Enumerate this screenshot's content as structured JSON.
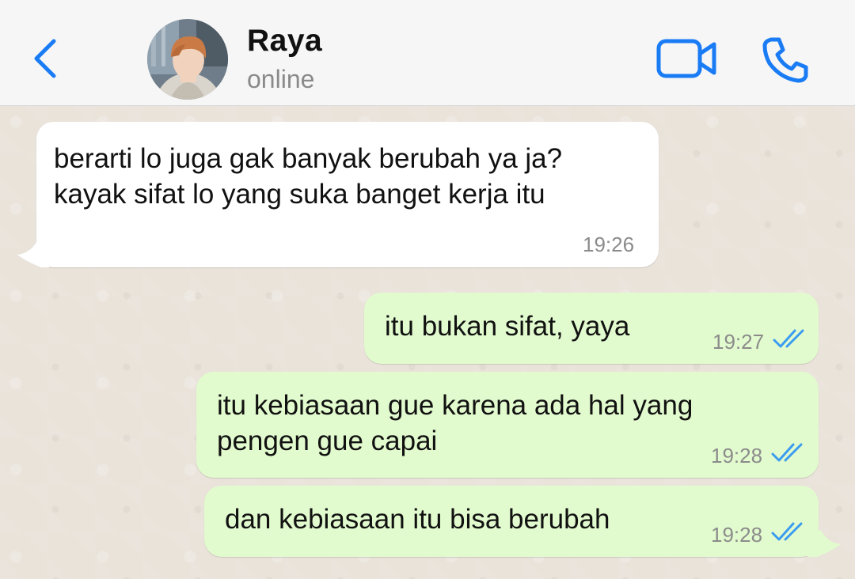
{
  "header": {
    "contact_name": "Raya",
    "contact_status": "online",
    "accent_color": "#1a7cf5"
  },
  "icons": {
    "back": "chevron-left-icon",
    "video": "video-camera-icon",
    "call": "phone-icon",
    "read_receipt": "double-check-icon"
  },
  "messages": [
    {
      "direction": "incoming",
      "lines": [
        "berarti lo juga gak banyak berubah ya ja?",
        "kayak sifat lo yang suka banget kerja itu"
      ],
      "time": "19:26"
    },
    {
      "direction": "outgoing",
      "lines": [
        "itu bukan sifat, yaya"
      ],
      "time": "19:27",
      "status": "read"
    },
    {
      "direction": "outgoing",
      "lines": [
        "itu kebiasaan gue karena ada hal yang",
        "pengen gue capai"
      ],
      "time": "19:28",
      "status": "read"
    },
    {
      "direction": "outgoing",
      "lines": [
        "dan kebiasaan itu bisa berubah"
      ],
      "time": "19:28",
      "status": "read"
    }
  ],
  "colors": {
    "incoming_bubble": "#ffffff",
    "outgoing_bubble": "#e2fbce",
    "read_tick": "#3a9cf0",
    "chat_background": "#e9e3da"
  }
}
